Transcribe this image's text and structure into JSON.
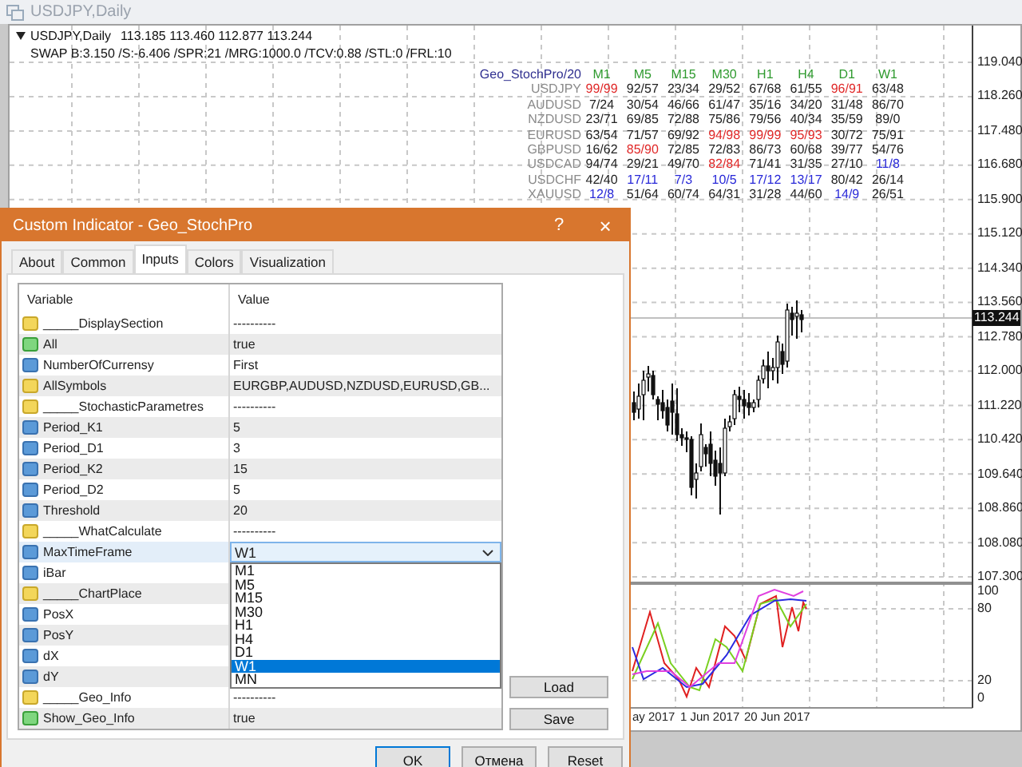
{
  "window": {
    "title": "USDJPY,Daily"
  },
  "chart": {
    "symbol": "USDJPY,Daily",
    "prices": "113.185 113.460 112.877 113.244",
    "swap": "SWAP B:3.150 /S:-6.406 /SPR:21 /MRG:1000.0 /TCV:0.88 /STL:0 /FRL:10",
    "price_labels": [
      "119.040",
      "118.260",
      "117.480",
      "116.680",
      "115.900",
      "115.120",
      "114.340",
      "113.560",
      "112.780",
      "112.000",
      "111.220",
      "110.420",
      "109.640",
      "108.860",
      "108.080",
      "107.300"
    ],
    "current_price": "113.244",
    "indicator_labels": [
      "100",
      "80",
      "20",
      "0"
    ],
    "dates": [
      "ay 2017",
      "1 Jun 2017",
      "20 Jun 2017"
    ]
  },
  "overlay_table": {
    "title": "Geo_StochPro/20",
    "columns": [
      "M1",
      "M5",
      "M15",
      "M30",
      "H1",
      "H4",
      "D1",
      "W1"
    ],
    "rows": [
      {
        "symbol": "USDJPY",
        "cells": [
          {
            "text": "99/99",
            "color": "#e02828"
          },
          {
            "text": "92/57",
            "color": "#222222"
          },
          {
            "text": "23/34",
            "color": "#222222"
          },
          {
            "text": "29/52",
            "color": "#222222"
          },
          {
            "text": "67/68",
            "color": "#222222"
          },
          {
            "text": "61/55",
            "color": "#222222"
          },
          {
            "text": "96/91",
            "color": "#e02828"
          },
          {
            "text": "63/48",
            "color": "#222222"
          }
        ]
      },
      {
        "symbol": "AUDUSD",
        "cells": [
          {
            "text": "7/24",
            "color": "#222222"
          },
          {
            "text": "30/54",
            "color": "#222222"
          },
          {
            "text": "46/66",
            "color": "#222222"
          },
          {
            "text": "61/47",
            "color": "#222222"
          },
          {
            "text": "35/16",
            "color": "#222222"
          },
          {
            "text": "34/20",
            "color": "#222222"
          },
          {
            "text": "31/48",
            "color": "#222222"
          },
          {
            "text": "86/70",
            "color": "#222222"
          }
        ]
      },
      {
        "symbol": "NZDUSD",
        "cells": [
          {
            "text": "23/71",
            "color": "#222222"
          },
          {
            "text": "69/85",
            "color": "#222222"
          },
          {
            "text": "72/88",
            "color": "#222222"
          },
          {
            "text": "75/86",
            "color": "#222222"
          },
          {
            "text": "79/56",
            "color": "#222222"
          },
          {
            "text": "40/34",
            "color": "#222222"
          },
          {
            "text": "35/59",
            "color": "#222222"
          },
          {
            "text": "89/0",
            "color": "#222222"
          }
        ]
      },
      {
        "symbol": "EURUSD",
        "cells": [
          {
            "text": "63/54",
            "color": "#222222"
          },
          {
            "text": "71/57",
            "color": "#222222"
          },
          {
            "text": "69/92",
            "color": "#222222"
          },
          {
            "text": "94/98",
            "color": "#e02828"
          },
          {
            "text": "99/99",
            "color": "#e02828"
          },
          {
            "text": "95/93",
            "color": "#e02828"
          },
          {
            "text": "30/72",
            "color": "#222222"
          },
          {
            "text": "75/91",
            "color": "#222222"
          }
        ]
      },
      {
        "symbol": "GBPUSD",
        "cells": [
          {
            "text": "16/62",
            "color": "#222222"
          },
          {
            "text": "85/90",
            "color": "#e02828"
          },
          {
            "text": "72/85",
            "color": "#222222"
          },
          {
            "text": "72/83",
            "color": "#222222"
          },
          {
            "text": "86/73",
            "color": "#222222"
          },
          {
            "text": "60/68",
            "color": "#222222"
          },
          {
            "text": "39/77",
            "color": "#222222"
          },
          {
            "text": "54/76",
            "color": "#222222"
          }
        ]
      },
      {
        "symbol": "USDCAD",
        "cells": [
          {
            "text": "94/74",
            "color": "#222222"
          },
          {
            "text": "29/21",
            "color": "#222222"
          },
          {
            "text": "49/70",
            "color": "#222222"
          },
          {
            "text": "82/84",
            "color": "#e02828"
          },
          {
            "text": "71/41",
            "color": "#222222"
          },
          {
            "text": "31/35",
            "color": "#222222"
          },
          {
            "text": "27/10",
            "color": "#222222"
          },
          {
            "text": "11/8",
            "color": "#2828d8"
          }
        ]
      },
      {
        "symbol": "USDCHF",
        "cells": [
          {
            "text": "42/40",
            "color": "#222222"
          },
          {
            "text": "17/11",
            "color": "#2828d8"
          },
          {
            "text": "7/3",
            "color": "#2828d8"
          },
          {
            "text": "10/5",
            "color": "#2828d8"
          },
          {
            "text": "17/12",
            "color": "#2828d8"
          },
          {
            "text": "13/17",
            "color": "#2828d8"
          },
          {
            "text": "80/42",
            "color": "#222222"
          },
          {
            "text": "26/14",
            "color": "#222222"
          }
        ]
      },
      {
        "symbol": "XAUUSD",
        "cells": [
          {
            "text": "12/8",
            "color": "#2828d8"
          },
          {
            "text": "51/64",
            "color": "#222222"
          },
          {
            "text": "60/74",
            "color": "#222222"
          },
          {
            "text": "64/31",
            "color": "#222222"
          },
          {
            "text": "31/28",
            "color": "#222222"
          },
          {
            "text": "44/60",
            "color": "#222222"
          },
          {
            "text": "14/9",
            "color": "#2828d8"
          },
          {
            "text": "26/51",
            "color": "#222222"
          }
        ]
      }
    ]
  },
  "dialog": {
    "title": "Custom Indicator - Geo_StochPro",
    "help": "?",
    "close": "×",
    "tabs": [
      {
        "label": "About",
        "selected": false
      },
      {
        "label": "Common",
        "selected": false
      },
      {
        "label": "Inputs",
        "selected": true
      },
      {
        "label": "Colors",
        "selected": false
      },
      {
        "label": "Visualization",
        "selected": false
      }
    ],
    "columns": [
      "Variable",
      "Value"
    ],
    "rows": [
      {
        "kind": "string",
        "name": "_____DisplaySection",
        "value": "----------",
        "selected": false
      },
      {
        "kind": "bool",
        "name": "All",
        "value": "true",
        "selected": false
      },
      {
        "kind": "int",
        "name": "NumberOfCurrensy",
        "value": "First",
        "selected": false
      },
      {
        "kind": "string",
        "name": "AllSymbols",
        "value": "EURGBP,AUDUSD,NZDUSD,EURUSD,GB...",
        "selected": false
      },
      {
        "kind": "string",
        "name": "_____StochasticParametres",
        "value": "----------",
        "selected": false
      },
      {
        "kind": "int",
        "name": "Period_K1",
        "value": "5",
        "selected": false
      },
      {
        "kind": "int",
        "name": "Period_D1",
        "value": "3",
        "selected": false
      },
      {
        "kind": "int",
        "name": "Period_K2",
        "value": "15",
        "selected": false
      },
      {
        "kind": "int",
        "name": "Period_D2",
        "value": "5",
        "selected": false
      },
      {
        "kind": "int",
        "name": "Threshold",
        "value": "20",
        "selected": false
      },
      {
        "kind": "string",
        "name": "_____WhatCalculate",
        "value": "----------",
        "selected": false
      },
      {
        "kind": "int",
        "name": "MaxTimeFrame",
        "selected": true,
        "dropdown": {
          "value": "W1",
          "options": [
            {
              "label": "M1",
              "selected": false
            },
            {
              "label": "M5",
              "selected": false
            },
            {
              "label": "M15",
              "selected": false
            },
            {
              "label": "M30",
              "selected": false
            },
            {
              "label": "H1",
              "selected": false
            },
            {
              "label": "H4",
              "selected": false
            },
            {
              "label": "D1",
              "selected": false
            },
            {
              "label": "W1",
              "selected": true
            },
            {
              "label": "MN",
              "selected": false
            }
          ]
        }
      },
      {
        "kind": "int",
        "name": "iBar",
        "selected": false
      },
      {
        "kind": "string",
        "name": "_____ChartPlace",
        "selected": false
      },
      {
        "kind": "int",
        "name": "PosX",
        "selected": false
      },
      {
        "kind": "int",
        "name": "PosY",
        "selected": false
      },
      {
        "kind": "int",
        "name": "dX",
        "selected": false
      },
      {
        "kind": "int",
        "name": "dY",
        "selected": false
      },
      {
        "kind": "string",
        "name": "_____Geo_Info",
        "value": "----------",
        "selected": false
      },
      {
        "kind": "bool",
        "name": "Show_Geo_Info",
        "value": "true",
        "selected": false
      }
    ],
    "side_buttons": [
      "Load",
      "Save"
    ],
    "buttons": [
      "OK",
      "Отмена",
      "Reset"
    ]
  }
}
